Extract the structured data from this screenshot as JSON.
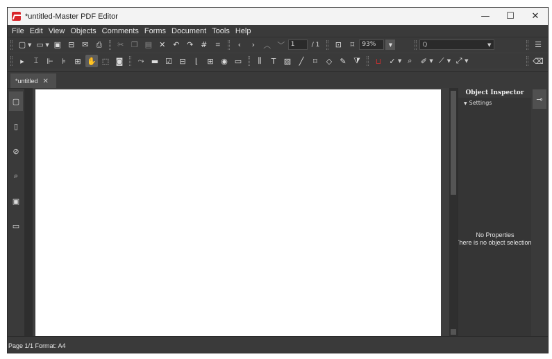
{
  "window": {
    "title": "*untitled-Master PDF Editor",
    "controls": {
      "minimize": "—",
      "maximize": "☐",
      "close": "✕"
    }
  },
  "menubar": {
    "items": [
      "File",
      "Edit",
      "View",
      "Objects",
      "Comments",
      "Forms",
      "Document",
      "Tools",
      "Help"
    ]
  },
  "toolbar": {
    "page_current": "1",
    "page_total": "/ 1",
    "zoom": "93%",
    "search_placeholder": "Q"
  },
  "tabs": [
    {
      "label": "*untitled",
      "close": "✕"
    }
  ],
  "inspector": {
    "title": "Object Inspector",
    "settings_label": "Settings",
    "no_properties": "No Properties",
    "no_selection": "There is no object selection"
  },
  "statusbar": {
    "text": "Page 1/1 Format: A4"
  }
}
